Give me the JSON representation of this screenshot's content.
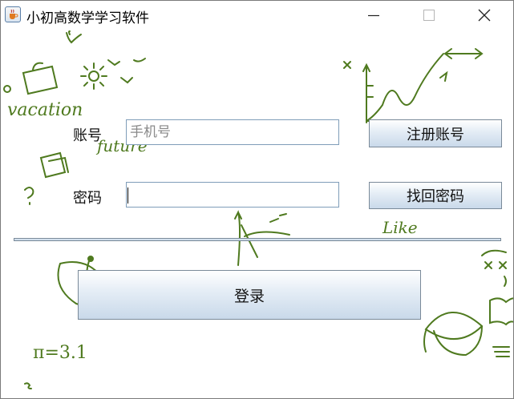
{
  "window": {
    "title": "小初高数学学习软件",
    "app_icon": "java-cup-icon",
    "controls": {
      "minimize": "minimize-icon",
      "maximize": "maximize-icon",
      "close": "close-icon"
    }
  },
  "form": {
    "account_label": "账号",
    "account_placeholder": "手机号",
    "account_value": "",
    "password_label": "密码",
    "password_value": "",
    "register_button": "注册账号",
    "recover_button": "找回密码",
    "login_button": "登录"
  },
  "background": {
    "doodle_words": [
      "vacation",
      "future",
      "Like",
      "π=3.1"
    ],
    "doodle_color": "#4f7a1f"
  },
  "colors": {
    "button_top": "#ffffff",
    "button_bottom": "#c9d9ea",
    "field_border": "#7f9db9"
  }
}
